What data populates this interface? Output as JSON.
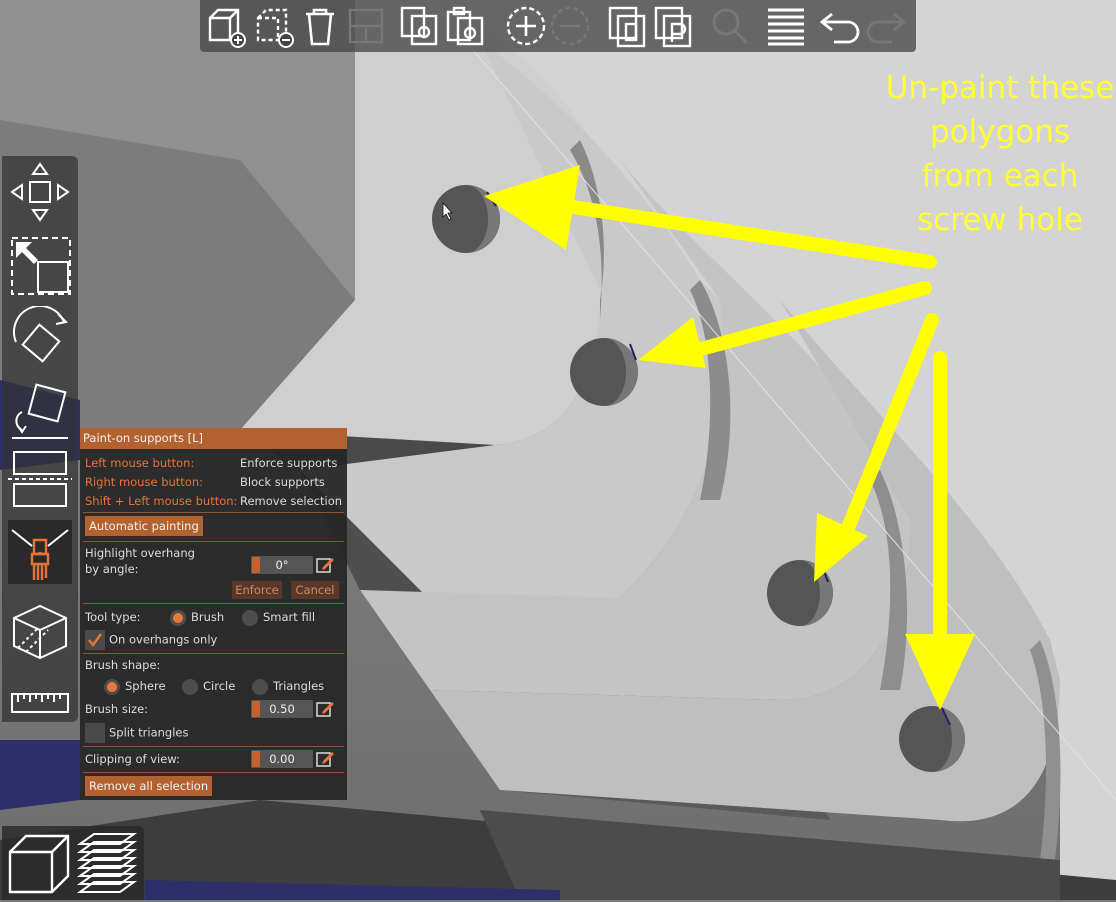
{
  "toolbar": {
    "buttons": [
      "add-icon",
      "delete-icon",
      "delete-all-icon",
      "arrange-icon",
      "copy-icon",
      "paste-icon",
      "add-instance-icon",
      "remove-instance-icon",
      "split-objects-icon",
      "split-parts-icon",
      "search-icon",
      "layers-editing-icon",
      "undo-icon",
      "redo-icon"
    ]
  },
  "sidebar": {
    "tools": [
      "move-icon",
      "scale-icon",
      "rotate-icon",
      "place-on-face-icon",
      "cut-icon",
      "paint-supports-icon",
      "seam-painting-icon",
      "measure-icon"
    ],
    "active_tool": "paint-supports-icon"
  },
  "view_toggle": [
    "3d-view-icon",
    "preview-icon"
  ],
  "panel": {
    "title": "Paint-on supports [L]",
    "left_mouse_label": "Left mouse button:",
    "left_mouse_value": "Enforce supports",
    "right_mouse_label": "Right mouse button:",
    "right_mouse_value": "Block supports",
    "shift_label": "Shift + Left mouse button:",
    "shift_value": "Remove selection",
    "automatic_painting": "Automatic painting",
    "highlight_label_1": "Highlight overhang",
    "highlight_label_2": "by angle:",
    "angle_value": "0°",
    "enforce_button": "Enforce",
    "cancel_button": "Cancel",
    "tool_type_label": "Tool type:",
    "tool_brush": "Brush",
    "tool_smart_fill": "Smart fill",
    "tool_type_selected": "Brush",
    "on_overhangs_label": "On overhangs only",
    "on_overhangs_checked": true,
    "brush_shape_label": "Brush shape:",
    "shape_sphere": "Sphere",
    "shape_circle": "Circle",
    "shape_triangles": "Triangles",
    "brush_shape_selected": "Sphere",
    "brush_size_label": "Brush size:",
    "brush_size_value": "0.50",
    "split_triangles_label": "Split triangles",
    "split_triangles_checked": false,
    "clipping_label": "Clipping of view:",
    "clipping_value": "0.00",
    "remove_all": "Remove all selection"
  },
  "annotation": {
    "line1": "Un-paint these",
    "line2": "polygons",
    "line3": "from each",
    "line4": "screw hole",
    "color": "#ffff33"
  },
  "colors": {
    "accent": "#e5733a",
    "panel_title_bg": "#b3612f"
  }
}
